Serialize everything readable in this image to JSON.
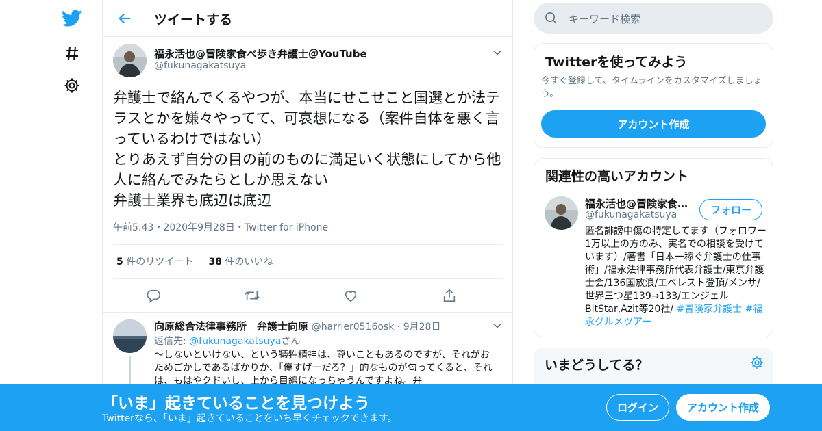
{
  "nav": {
    "icons": [
      "twitter-bird-icon",
      "hashtag-icon",
      "gear-icon"
    ]
  },
  "header": {
    "title": "ツイートする"
  },
  "tweet": {
    "author_name": "福永活也@冒険家食べ歩き弁護士＠YouTube",
    "author_handle": "@fukunagakatsuya",
    "body": "弁護士で絡んでくるやつが、本当にせこせこと国選とか法テラスとかを嫌々やってて、可哀想になる（案件自体を悪く言っているわけではない）\nとりあえず自分の目の前のものに満足いく状態にしてから他人に絡んでみたらとしか思えない\n弁護士業界も底辺は底辺",
    "meta": "午前5:43・2020年9月28日・Twitter for iPhone",
    "retweet_count": "5",
    "retweet_label": "件のリツイート",
    "like_count": "38",
    "like_label": "件のいいね"
  },
  "reply": {
    "name": "向原総合法律事務所　弁護士向原",
    "handle": "@harrier0516osk",
    "date": "9月28日",
    "reply_to_prefix": "返信先: ",
    "reply_to_handle": "@fukunagakatsuya",
    "reply_to_suffix": "さん",
    "text": "～しないといけない、という犠牲精神は、尊いこともあるのですが、それがおためごかしであるばかりか、「俺すげーだろ？」的なものが匂ってくると、それは、もはやクドいし、上から目線になっちゃうんですよね。弁"
  },
  "search": {
    "placeholder": "キーワード検索"
  },
  "signup_card": {
    "title": "Twitterを使ってみよう",
    "subtitle": "今すぐ登録して、タイムラインをカスタマイズしましょう。",
    "button": "アカウント作成"
  },
  "related_card": {
    "title": "関連性の高いアカウント",
    "name": "福永活也@冒険家食…",
    "handle": "@fukunagakatsuya",
    "follow": "フォロー",
    "bio": "匿名誹謗中傷の特定してます（フォロワー1万以上の方のみ、実名での相談を受けています）/著書「日本一稼ぐ弁護士の仕事術」/福永法律事務所代表弁護士/東京弁護士会/136国放浪/エベレスト登頂/メンサ/世界三つ星139→133/エンジェルBitStar,Azit等20社/ ",
    "tag1": "#冒険家弁護士",
    "tag2": "#福永グルメツアー"
  },
  "trends_card": {
    "title": "いまどうしてる？"
  },
  "banner": {
    "title": "「いま」起きていることを見つけよう",
    "subtitle": "Twitterなら、「いま」起きていることをいち早くチェックできます。",
    "login": "ログイン",
    "signup": "アカウント作成"
  },
  "colors": {
    "accent": "#1da1f2",
    "text": "#14171a",
    "secondary": "#657786",
    "border": "#e6ecf0"
  }
}
